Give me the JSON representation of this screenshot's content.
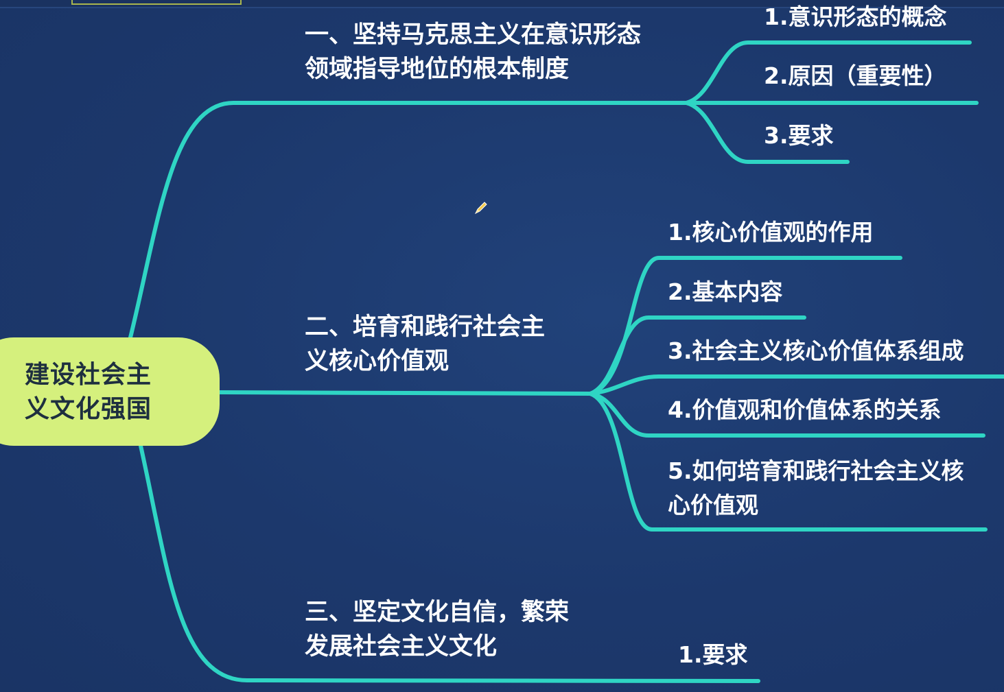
{
  "root": {
    "label": "建设社会主义文化强国"
  },
  "branches": [
    {
      "label": "一、坚持马克思主义在意识形态领域指导地位的根本制度",
      "children": [
        "1.意识形态的概念",
        "2.原因（重要性）",
        "3.要求"
      ]
    },
    {
      "label": "二、培育和践行社会主义核心价值观",
      "children": [
        "1.核心价值观的作用",
        "2.基本内容",
        "3.社会主义核心价值体系组成",
        "4.价值观和价值体系的关系",
        "5.如何培育和践行社会主义核心价值观"
      ]
    },
    {
      "label": "三、坚定文化自信，繁荣发展社会主义文化",
      "children": [
        "1.要求"
      ]
    }
  ],
  "colors": {
    "background": "#1d3a6f",
    "line": "#2fd5c4",
    "root_fill": "#d5f07d",
    "root_text": "#1e2f3f",
    "text": "#ffffff"
  },
  "icons": {
    "cursor": "pencil-icon"
  }
}
